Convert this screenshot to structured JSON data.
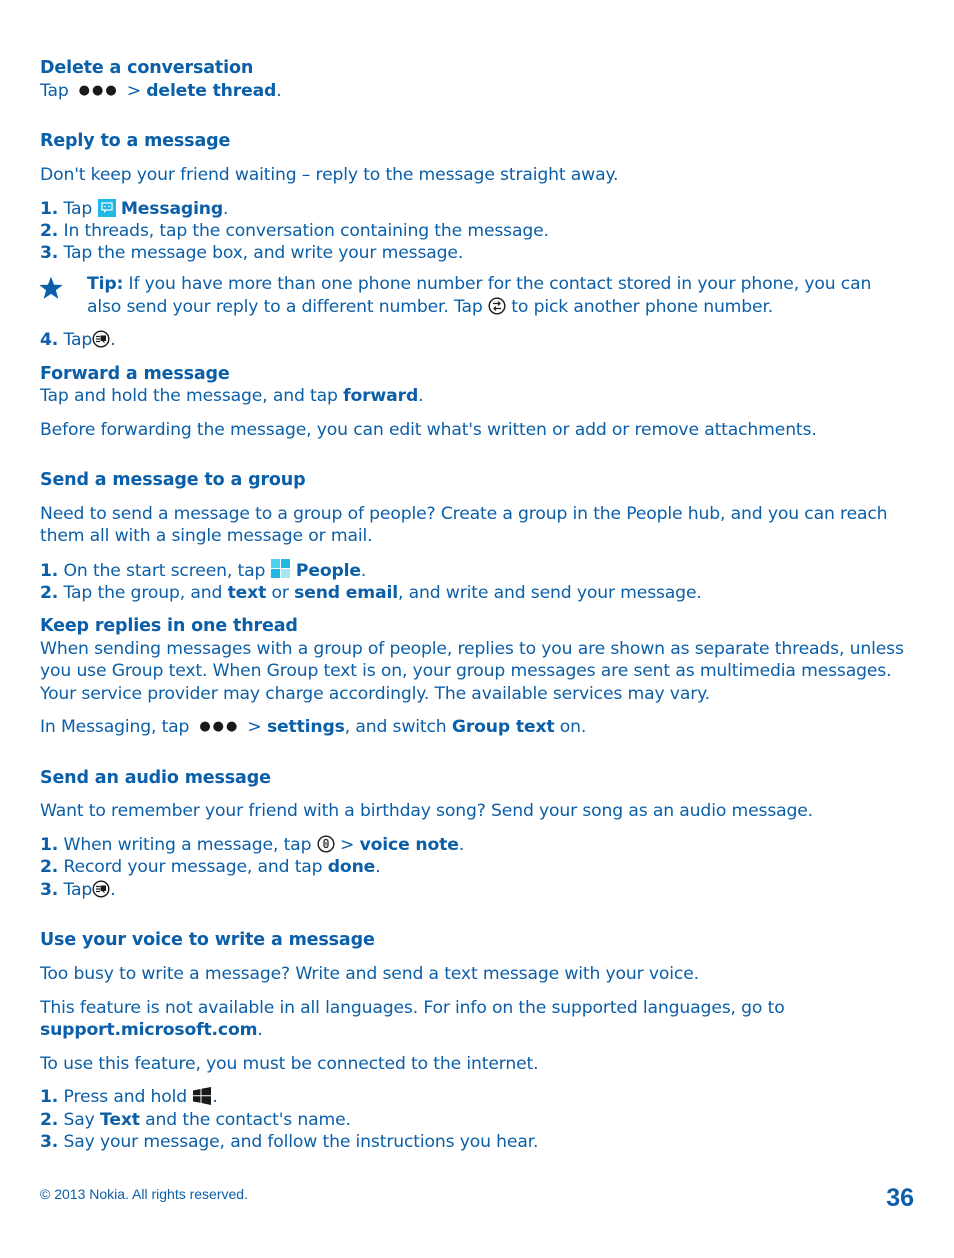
{
  "sections": {
    "delete": {
      "heading": "Delete a conversation",
      "line_tap": "Tap",
      "line_gt": ">",
      "line_action": "delete thread",
      "line_end": "."
    },
    "reply": {
      "heading": "Reply to a message",
      "intro": "Don't keep your friend waiting – reply to the message straight away.",
      "steps": [
        {
          "num": "1.",
          "pre": "Tap",
          "bold": "Messaging",
          "post": "."
        },
        {
          "num": "2.",
          "text": "In threads, tap the conversation containing the message."
        },
        {
          "num": "3.",
          "text": "Tap the message box, and write your message."
        },
        {
          "num": "4.",
          "pre": "Tap",
          "post": "."
        }
      ],
      "tip": {
        "label": "Tip:",
        "line1": "If you have more than one phone number for the contact stored in your phone, you can",
        "line2_pre": "also send your reply to a different number. Tap",
        "line2_post": "to pick another phone number."
      }
    },
    "forward": {
      "heading": "Forward a message",
      "line1_pre": "Tap and hold the message, and tap",
      "line1_bold": "forward",
      "line1_post": ".",
      "para": "Before forwarding the message, you can edit what's written or add or remove attachments."
    },
    "group": {
      "heading": "Send a message to a group",
      "intro1": "Need to send a message to a group of people? Create a group in the People hub, and you can reach",
      "intro2": "them all with a single message or mail.",
      "step1": {
        "num": "1.",
        "pre": "On the start screen, tap",
        "bold": "People",
        "post": "."
      },
      "step2": {
        "num": "2.",
        "pre": "Tap the group, and",
        "bold1": "text",
        "mid": "or",
        "bold2": "send email",
        "post": ", and write and send your message."
      }
    },
    "keep": {
      "heading": "Keep replies in one thread",
      "lines": [
        "When sending messages with a group of people, replies to you are shown as separate threads, unless",
        "you use Group text. When Group text is on, your group messages are sent as multimedia messages.",
        "Your service provider may charge accordingly. The available services may vary."
      ],
      "settings_pre": "In Messaging, tap",
      "settings_gt": ">",
      "settings_bold": "settings",
      "settings_mid": ", and switch",
      "settings_bold2": "Group text",
      "settings_post": "on."
    },
    "audio": {
      "heading": "Send an audio message",
      "intro": "Want to remember your friend with a birthday song? Send your song as an audio message.",
      "step1": {
        "num": "1.",
        "pre": "When writing a message, tap",
        "gt": ">",
        "bold": "voice note",
        "post": "."
      },
      "step2": {
        "num": "2.",
        "pre": "Record your message, and tap",
        "bold": "done",
        "post": "."
      },
      "step3": {
        "num": "3.",
        "pre": "Tap",
        "post": "."
      }
    },
    "voice": {
      "heading": "Use your voice to write a message",
      "intro": "Too busy to write a message? Write and send a text message with your voice.",
      "avail1": "This feature is not available in all languages. For info on the supported languages, go to",
      "avail_link": "support.microsoft.com",
      "avail_end": ".",
      "internet": "To use this feature, you must be connected to the internet.",
      "step1": {
        "num": "1.",
        "pre": "Press and hold",
        "post": "."
      },
      "step2": {
        "num": "2.",
        "pre": "Say",
        "bold": "Text",
        "post": "and the contact's name."
      },
      "step3": {
        "num": "3.",
        "text": "Say your message, and follow the instructions you hear."
      }
    }
  },
  "footer": {
    "copyright": "© 2013 Nokia. All rights reserved.",
    "page_number": "36"
  },
  "colors": {
    "text": "#0b5fa8",
    "icon_tile": "#21b8e6",
    "icon_dark": "#1a1a1a"
  }
}
